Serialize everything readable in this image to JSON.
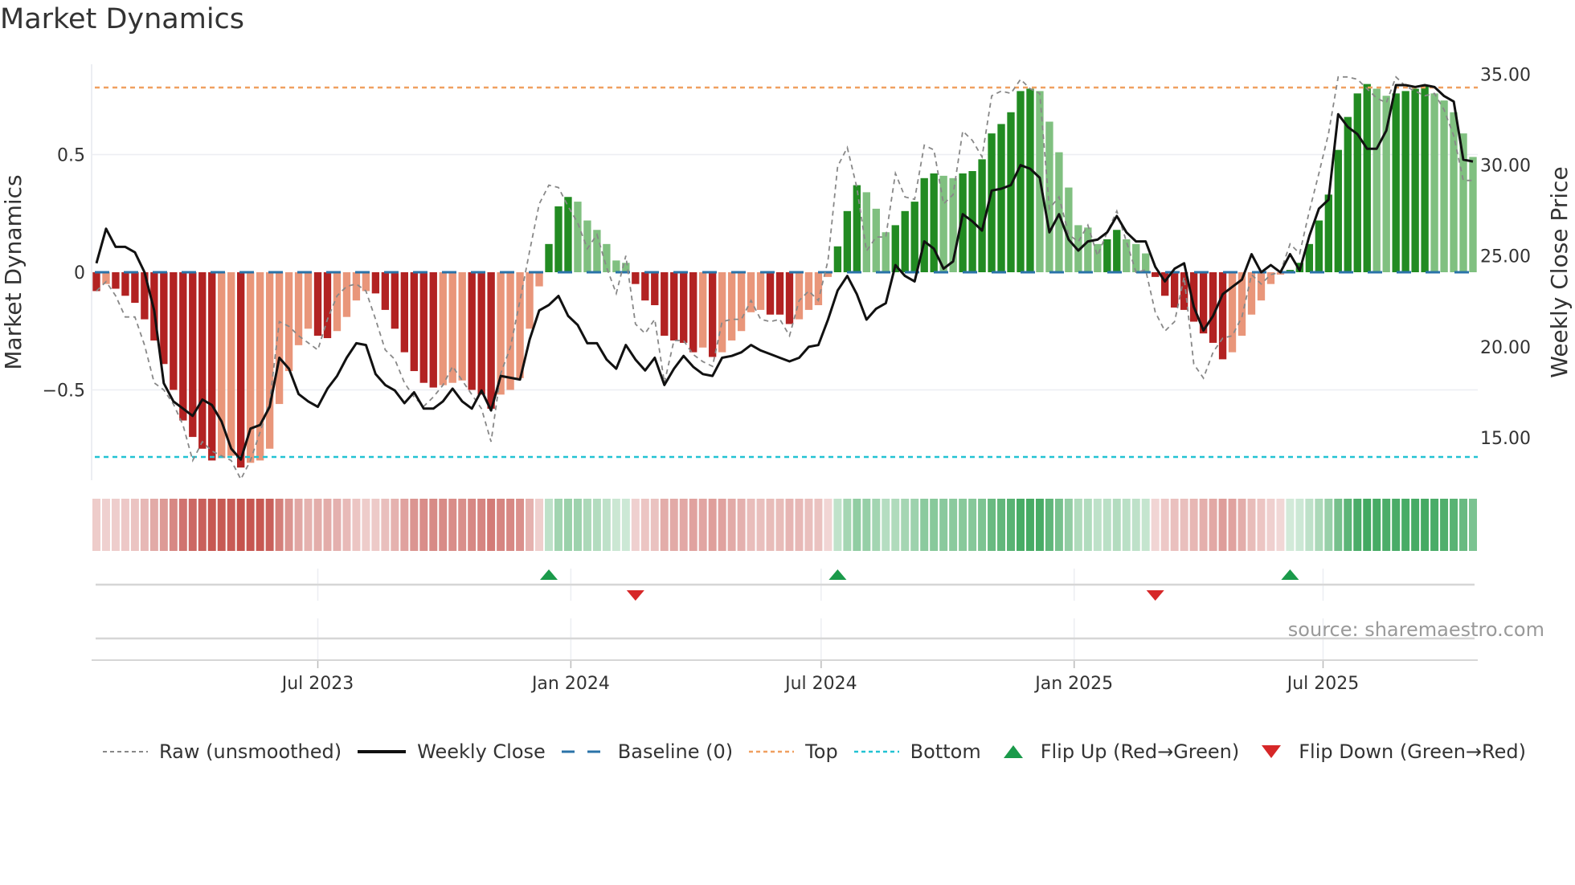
{
  "title": "Market Dynamics",
  "source": "source: sharemaestro.com",
  "legend": {
    "raw": "Raw (unsmoothed)",
    "close": "Weekly Close",
    "baseline": "Baseline (0)",
    "top": "Top",
    "bottom": "Bottom",
    "flip_up": "Flip Up (Red→Green)",
    "flip_down": "Flip Down (Green→Red)"
  },
  "colors": {
    "red_strong": "#b22222",
    "red_weak": "#e9967a",
    "green_strong": "#228b22",
    "green_weak": "#80c080",
    "strip_red": "#c4504a",
    "strip_green": "#3aa55a",
    "raw": "#888888",
    "close": "#111111",
    "baseline": "#2a73a8",
    "top": "#f0a060",
    "bottom": "#22c3d3",
    "flip_up": "#1a9a4a",
    "flip_down": "#d62728"
  },
  "chart_data": {
    "type": "bar",
    "title": "Market Dynamics",
    "ylabel": "Market Dynamics",
    "y2label": "Weekly Close Price",
    "frequency": "weekly",
    "first_week": "2023-01-21",
    "ylim": [
      -0.884,
      0.884
    ],
    "y2lim": [
      12.66,
      35.55
    ],
    "yticks": [
      {
        "v": 0.5,
        "label": "0.5"
      },
      {
        "v": 0,
        "label": "0"
      },
      {
        "v": -0.5,
        "label": "−0.5"
      }
    ],
    "y2ticks": [
      {
        "v": 35,
        "label": "35.00"
      },
      {
        "v": 30,
        "label": "30.00"
      },
      {
        "v": 25,
        "label": "25.00"
      },
      {
        "v": 20,
        "label": "20.00"
      },
      {
        "v": 15,
        "label": "15.00"
      }
    ],
    "xticks": [
      {
        "date": "2023-07-01",
        "label": "Jul 2023"
      },
      {
        "date": "2024-01-01",
        "label": "Jan 2024"
      },
      {
        "date": "2024-07-01",
        "label": "Jul 2024"
      },
      {
        "date": "2025-01-01",
        "label": "Jan 2025"
      },
      {
        "date": "2025-07-01",
        "label": "Jul 2025"
      }
    ],
    "top_level": 0.785,
    "bottom_level": -0.785,
    "baseline": 0,
    "market_dynamics": [
      -0.08,
      -0.05,
      -0.07,
      -0.1,
      -0.13,
      -0.2,
      -0.29,
      -0.39,
      -0.5,
      -0.63,
      -0.7,
      -0.75,
      -0.8,
      -0.79,
      -0.78,
      -0.83,
      -0.81,
      -0.8,
      -0.75,
      -0.56,
      -0.42,
      -0.31,
      -0.24,
      -0.27,
      -0.28,
      -0.25,
      -0.19,
      -0.12,
      -0.08,
      -0.09,
      -0.16,
      -0.24,
      -0.34,
      -0.42,
      -0.47,
      -0.49,
      -0.48,
      -0.47,
      -0.46,
      -0.5,
      -0.52,
      -0.58,
      -0.52,
      -0.5,
      -0.45,
      -0.24,
      -0.06,
      0.12,
      0.28,
      0.32,
      0.3,
      0.22,
      0.18,
      0.12,
      0.05,
      0.04,
      -0.05,
      -0.12,
      -0.14,
      -0.27,
      -0.29,
      -0.3,
      -0.34,
      -0.32,
      -0.36,
      -0.34,
      -0.29,
      -0.25,
      -0.17,
      -0.16,
      -0.18,
      -0.18,
      -0.22,
      -0.2,
      -0.16,
      -0.14,
      -0.02,
      0.11,
      0.26,
      0.37,
      0.34,
      0.27,
      0.17,
      0.2,
      0.26,
      0.3,
      0.4,
      0.42,
      0.41,
      0.4,
      0.42,
      0.43,
      0.48,
      0.59,
      0.63,
      0.68,
      0.77,
      0.78,
      0.77,
      0.64,
      0.51,
      0.36,
      0.2,
      0.19,
      0.12,
      0.14,
      0.18,
      0.14,
      0.12,
      0.08,
      -0.02,
      -0.1,
      -0.15,
      -0.16,
      -0.21,
      -0.26,
      -0.3,
      -0.37,
      -0.34,
      -0.27,
      -0.18,
      -0.12,
      -0.05,
      -0.01,
      0.01,
      0.04,
      0.12,
      0.22,
      0.33,
      0.52,
      0.66,
      0.76,
      0.8,
      0.78,
      0.75,
      0.76,
      0.77,
      0.78,
      0.79,
      0.76,
      0.73,
      0.68,
      0.59,
      0.49
    ],
    "raw": [
      -0.08,
      -0.04,
      -0.1,
      -0.19,
      -0.19,
      -0.31,
      -0.47,
      -0.5,
      -0.56,
      -0.65,
      -0.8,
      -0.72,
      -0.76,
      -0.78,
      -0.8,
      -0.88,
      -0.8,
      -0.68,
      -0.55,
      -0.21,
      -0.23,
      -0.27,
      -0.3,
      -0.33,
      -0.2,
      -0.1,
      -0.06,
      -0.05,
      -0.08,
      -0.2,
      -0.33,
      -0.37,
      -0.47,
      -0.53,
      -0.57,
      -0.53,
      -0.48,
      -0.4,
      -0.46,
      -0.52,
      -0.58,
      -0.72,
      -0.43,
      -0.32,
      -0.12,
      0.09,
      0.29,
      0.37,
      0.36,
      0.28,
      0.21,
      0.1,
      0.16,
      0.02,
      -0.09,
      0.07,
      -0.22,
      -0.26,
      -0.2,
      -0.47,
      -0.29,
      -0.29,
      -0.35,
      -0.38,
      -0.4,
      -0.21,
      -0.2,
      -0.2,
      -0.12,
      -0.2,
      -0.21,
      -0.2,
      -0.27,
      -0.12,
      -0.08,
      -0.12,
      0.05,
      0.45,
      0.53,
      0.36,
      0.09,
      0.15,
      0.15,
      0.42,
      0.32,
      0.31,
      0.54,
      0.52,
      0.29,
      0.33,
      0.6,
      0.56,
      0.49,
      0.75,
      0.77,
      0.76,
      0.82,
      0.78,
      0.76,
      0.27,
      0.32,
      0.16,
      0.13,
      0.2,
      0.07,
      0.17,
      0.26,
      0.13,
      0.0,
      0.01,
      -0.17,
      -0.25,
      -0.21,
      -0.02,
      -0.39,
      -0.45,
      -0.34,
      -0.28,
      -0.27,
      -0.19,
      -0.01,
      -0.05,
      -0.01,
      0.0,
      0.12,
      0.08,
      0.26,
      0.42,
      0.59,
      0.83,
      0.83,
      0.82,
      0.78,
      0.74,
      0.72,
      0.83,
      0.79,
      0.77,
      0.75,
      0.76,
      0.69,
      0.58,
      0.39,
      0.39
    ],
    "weekly_close": [
      24.6,
      26.5,
      25.5,
      25.5,
      25.2,
      24.1,
      22.0,
      18.0,
      17.0,
      16.6,
      16.2,
      17.1,
      16.8,
      15.9,
      14.4,
      13.8,
      15.5,
      15.7,
      16.7,
      19.4,
      18.8,
      17.4,
      17.0,
      16.7,
      17.7,
      18.4,
      19.4,
      20.2,
      20.1,
      18.5,
      17.9,
      17.6,
      16.9,
      17.5,
      16.6,
      16.6,
      17.0,
      17.7,
      17.0,
      16.6,
      17.6,
      16.5,
      18.4,
      18.3,
      18.2,
      20.4,
      22.0,
      22.3,
      22.8,
      21.7,
      21.2,
      20.2,
      20.2,
      19.3,
      18.8,
      20.1,
      19.3,
      18.7,
      19.4,
      17.9,
      18.8,
      19.5,
      18.9,
      18.5,
      18.4,
      19.4,
      19.5,
      19.7,
      20.1,
      19.8,
      19.6,
      19.4,
      19.2,
      19.4,
      20.0,
      20.1,
      21.5,
      23.1,
      23.9,
      22.9,
      21.5,
      22.1,
      22.4,
      24.5,
      23.9,
      23.6,
      25.8,
      25.4,
      24.3,
      24.7,
      27.3,
      26.9,
      26.4,
      28.6,
      28.7,
      28.9,
      30.0,
      29.8,
      29.3,
      26.3,
      27.3,
      25.9,
      25.3,
      25.8,
      25.9,
      26.3,
      27.2,
      26.3,
      25.8,
      25.8,
      24.4,
      23.6,
      24.3,
      24.6,
      22.2,
      20.9,
      21.7,
      22.9,
      23.3,
      23.7,
      25.1,
      24.1,
      24.5,
      24.1,
      25.1,
      24.2,
      26.1,
      27.6,
      28.1,
      32.8,
      32.1,
      31.7,
      30.9,
      30.9,
      31.9,
      34.4,
      34.4,
      34.3,
      34.4,
      34.3,
      33.8,
      33.5,
      30.3,
      30.2
    ]
  }
}
